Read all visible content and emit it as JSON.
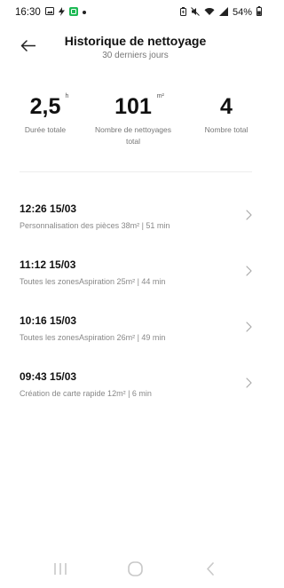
{
  "status_bar": {
    "time": "16:30",
    "battery": "54%",
    "left_icons": [
      "image-icon",
      "flash-icon",
      "app-notification-icon",
      "dot-icon"
    ],
    "right_icons": [
      "battery-saver-icon",
      "mute-icon",
      "wifi-icon",
      "signal-icon",
      "battery-icon"
    ]
  },
  "header": {
    "title": "Historique de nettoyage",
    "subtitle": "30 derniers jours",
    "back_icon": "arrow-left-icon"
  },
  "stats": [
    {
      "value": "2,5",
      "unit": "h",
      "label": "Durée totale"
    },
    {
      "value": "101",
      "unit": "m²",
      "label": "Nombre de nettoyages total"
    },
    {
      "value": "4",
      "unit": "",
      "label": "Nombre total"
    }
  ],
  "records": [
    {
      "time": "12:26 15/03",
      "detail": "Personnalisation des pièces 38m² | 51 min"
    },
    {
      "time": "11:12 15/03",
      "detail": "Toutes les zonesAspiration 25m² | 44 min"
    },
    {
      "time": "10:16 15/03",
      "detail": "Toutes les zonesAspiration 26m² | 49 min"
    },
    {
      "time": "09:43 15/03",
      "detail": "Création de carte rapide 12m² | 6 min"
    }
  ],
  "nav_bar": {
    "icons": [
      "recent-apps-icon",
      "home-icon",
      "back-icon"
    ]
  },
  "colors": {
    "text_primary": "#111111",
    "text_secondary": "#888888",
    "divider": "#ececec",
    "background": "#ffffff",
    "app_icon_accent": "#1db954"
  }
}
